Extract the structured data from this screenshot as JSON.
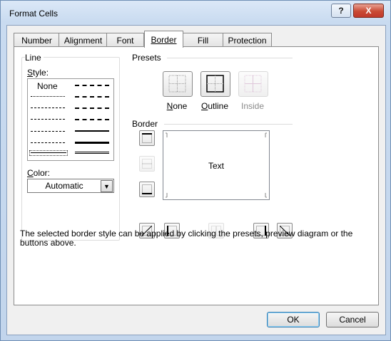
{
  "window": {
    "title": "Format Cells",
    "help_label": "?",
    "close_label": "X"
  },
  "tabs": [
    {
      "label": "Number",
      "active": false
    },
    {
      "label": "Alignment",
      "active": false
    },
    {
      "label": "Font",
      "active": false
    },
    {
      "label": "Border",
      "active": true
    },
    {
      "label": "Fill",
      "active": false
    },
    {
      "label": "Protection",
      "active": false
    }
  ],
  "line": {
    "section_label": "Line",
    "style_label": "Style:",
    "style_none": "None",
    "color_label": "Color:",
    "color_value": "Automatic"
  },
  "presets": {
    "section_label": "Presets",
    "items": [
      {
        "label": "None",
        "enabled": true
      },
      {
        "label": "Outline",
        "enabled": true
      },
      {
        "label": "Inside",
        "enabled": false
      }
    ]
  },
  "border": {
    "section_label": "Border",
    "preview_text": "Text"
  },
  "hint": "The selected border style can be applied by clicking the presets, preview diagram or the buttons above.",
  "buttons": {
    "ok": "OK",
    "cancel": "Cancel"
  }
}
